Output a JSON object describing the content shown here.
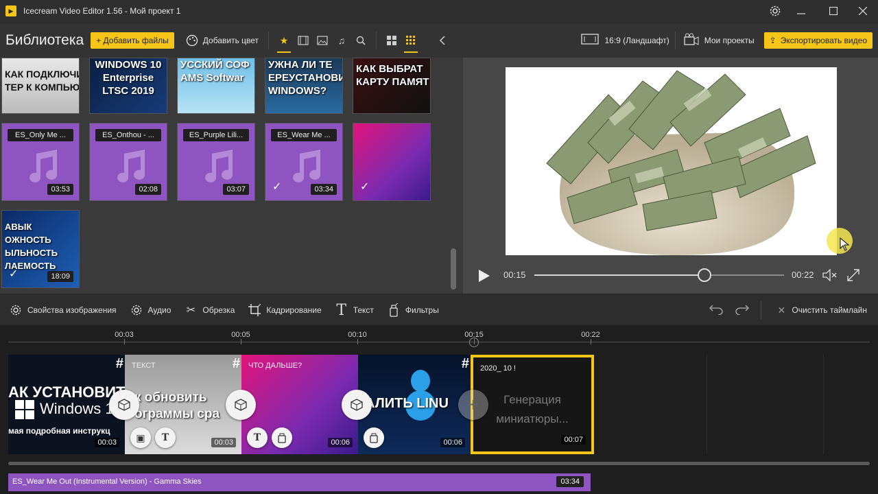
{
  "window": {
    "title": "Icecream Video Editor 1.56  -  Мой проект 1",
    "controls": [
      "gear-icon",
      "minimize-icon",
      "maximize-icon",
      "close-icon"
    ]
  },
  "library": {
    "title": "Библиотека",
    "add_files": "+ Добавить файлы",
    "add_color": "Добавить цвет",
    "tools": [
      "star-icon",
      "film-icon",
      "image-icon",
      "music-icon",
      "search-icon",
      "grid-large-icon",
      "grid-small-icon",
      "chevron-left-icon"
    ],
    "video_thumbs": [
      {
        "text": "КАК ПОДКЛЮЧИТ\nТЕР К КОМПЬЮ"
      },
      {
        "text": "WINDOWS 10\nEnterprise\nLTSC 2019"
      },
      {
        "text": "УССКИЙ СОФ\nAMS Softwar"
      },
      {
        "text": "УЖНА ЛИ ТЕ\nЕРЕУСТАНОВИ\nWINDOWS?"
      },
      {
        "text": "КАК ВЫБРАТ\nКАРТУ ПАМЯТ"
      }
    ],
    "audio_tiles": [
      {
        "name": "ES_Only Me ...",
        "duration": "03:53",
        "checked": false
      },
      {
        "name": "ES_Onthou - ...",
        "duration": "02:08",
        "checked": false
      },
      {
        "name": "ES_Purple Lili...",
        "duration": "03:07",
        "checked": false
      },
      {
        "name": "ES_Wear Me ...",
        "duration": "03:34",
        "checked": true
      }
    ],
    "gradient_tile": {
      "checked": true
    },
    "last_thumb": {
      "text": "АВЫК\nОЖНОСТЬ\nЫЛЬНОСТЬ\nЛАЕМОСТЬ",
      "duration": "18:09",
      "checked": true
    }
  },
  "header_right": {
    "aspect": "16:9 (Ландшафт)",
    "projects": "Мои проекты",
    "export": "Экспортировать видео"
  },
  "player": {
    "current_time": "00:15",
    "total_time": "00:22",
    "progress": 0.68
  },
  "edit_toolbar": {
    "image_props": "Свойства изображения",
    "audio": "Аудио",
    "trim": "Обрезка",
    "crop": "Кадрирование",
    "text": "Текст",
    "filters": "Фильтры",
    "clear": "Очистить таймлайн"
  },
  "timeline": {
    "ticks": [
      "00:03",
      "00:05",
      "00:10",
      "00:15",
      "00:22"
    ],
    "clips": [
      {
        "title": "АК УСТАНОВИТ",
        "subtitle": "Windows 1",
        "caption": "мая подробная инструкц",
        "duration": "00:03"
      },
      {
        "label": "ТЕКСТ",
        "title": "к обновить",
        "subtitle": "ограммы сра",
        "duration": "00:03"
      },
      {
        "label": "ЧТО ДАЛЬШЕ?",
        "duration": "00:06"
      },
      {
        "title": "АЛИТЬ LINU",
        "duration": "00:06"
      },
      {
        "label": "2020_ 10 !",
        "gen_text": "Генерация миниатюры...",
        "duration": "00:07"
      }
    ],
    "audio_track": {
      "name": "ES_Wear Me Out (Instrumental Version) - Gamma Skies",
      "duration": "03:34"
    }
  },
  "colors": {
    "accent": "#f5c518",
    "audio": "#8e55c0",
    "bg": "#2b2b2b"
  }
}
